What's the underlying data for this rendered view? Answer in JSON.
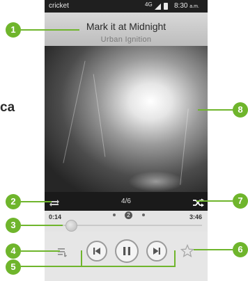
{
  "status_bar": {
    "carrier": "cricket",
    "network": "4G",
    "time": "8:30",
    "ampm": "a.m."
  },
  "now_playing": {
    "title": "Mark it at Midnight",
    "artist": "Urban Ignition",
    "track_position": "4/6",
    "elapsed": "0:14",
    "total": "3:46",
    "progress_fraction": 0.062,
    "page_indicator": "2"
  },
  "side_text": "ca",
  "callouts": [
    "1",
    "2",
    "3",
    "4",
    "5",
    "6",
    "7",
    "8"
  ],
  "icons": {
    "repeat": "repeat-icon",
    "shuffle": "shuffle-icon",
    "playlist": "playlist-icon",
    "previous": "previous-icon",
    "pause": "pause-icon",
    "next": "next-icon",
    "favorite": "star-icon"
  },
  "colors": {
    "callout": "#6fb52c",
    "status_bar": "#1f1f1f",
    "repeat_bar": "#1a1a1a"
  }
}
